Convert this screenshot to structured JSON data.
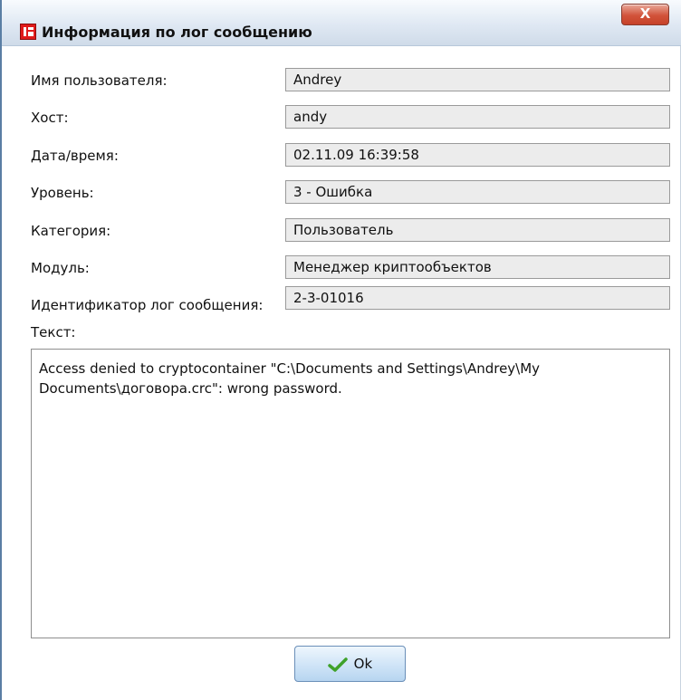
{
  "window": {
    "title": "Информация по лог сообщению",
    "close_label": "X",
    "icons": {
      "app": "app-icon",
      "close": "close-icon",
      "ok": "checkmark-icon"
    }
  },
  "fields": {
    "username": {
      "label": "Имя пользователя:",
      "value": "Andrey"
    },
    "host": {
      "label": "Хост:",
      "value": "andy"
    },
    "datetime": {
      "label": "Дата/время:",
      "value": "02.11.09 16:39:58"
    },
    "level": {
      "label": "Уровень:",
      "value": "3 - Ошибка"
    },
    "category": {
      "label": "Категория:",
      "value": "Пользователь"
    },
    "module": {
      "label": "Модуль:",
      "value": "Менеджер криптообъектов"
    },
    "message_id": {
      "label": "Идентификатор лог сообщения:",
      "value": "2-3-01016"
    }
  },
  "text_section": {
    "label": "Текст:",
    "content": "Access denied to cryptocontainer \"C:\\Documents and Settings\\Andrey\\My Documents\\договора.crc\": wrong password."
  },
  "buttons": {
    "ok_label": "Ok"
  }
}
